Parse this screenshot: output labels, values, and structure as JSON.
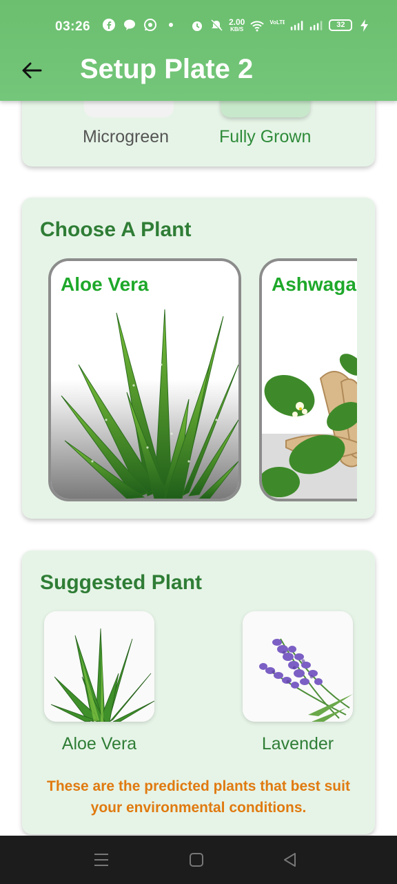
{
  "status_bar": {
    "time": "03:26",
    "net_speed_value": "2.00",
    "net_speed_unit": "KB/S",
    "volte": "VoLTE",
    "battery": "32"
  },
  "header": {
    "title": "Setup Plate 2",
    "back_icon": "arrow-left-icon"
  },
  "growth_stage": {
    "options": [
      {
        "label": "Microgreen",
        "selected": false
      },
      {
        "label": "Fully Grown",
        "selected": true
      }
    ]
  },
  "choose_plant": {
    "title": "Choose A Plant",
    "plants": [
      {
        "name": "Aloe Vera",
        "image": "aloe-vera-image"
      },
      {
        "name": "Ashwagandha",
        "image": "ashwagandha-image"
      }
    ]
  },
  "suggested": {
    "title": "Suggested Plant",
    "plants": [
      {
        "name": "Aloe Vera",
        "image": "aloe-vera-image"
      },
      {
        "name": "Lavender",
        "image": "lavender-image"
      }
    ],
    "note": "These are the predicted plants that best suit your environmental conditions."
  },
  "nav_bar": {
    "buttons": [
      "menu-icon",
      "home-icon",
      "back-triangle-icon"
    ]
  },
  "colors": {
    "appbar": "#6cc070",
    "card_bg": "#e6f4e7",
    "title_green": "#2f7d36",
    "plant_name_green": "#1ea82a",
    "note_orange": "#e07a10"
  }
}
